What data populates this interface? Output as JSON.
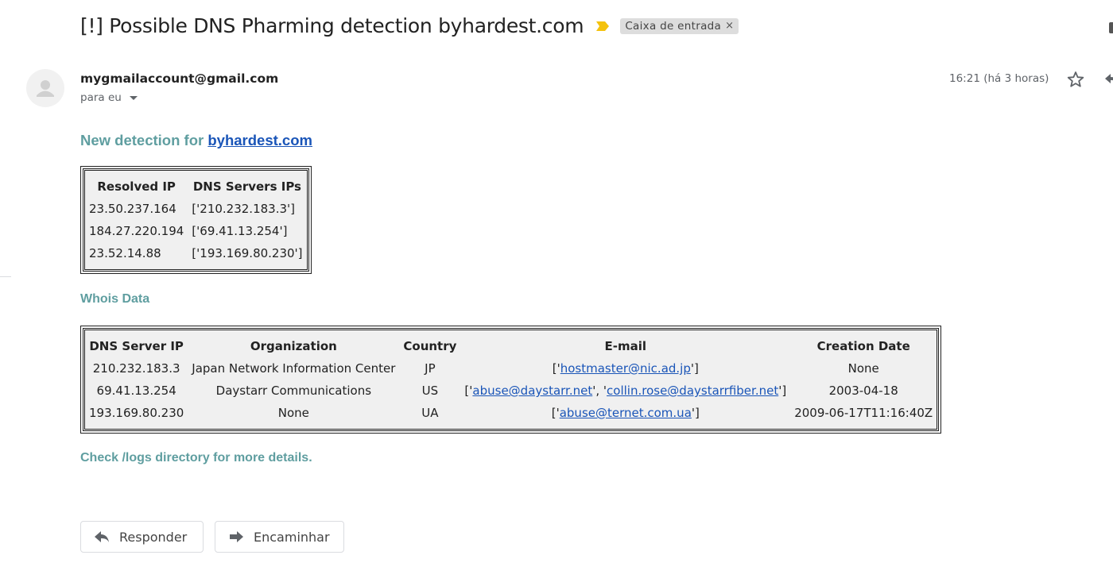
{
  "email": {
    "subject": "[!] Possible DNS Pharming detection byhardest.com",
    "label": "Caixa de entrada",
    "label_close": "×",
    "sender": "mygmailaccount@gmail.com",
    "recipient": "para eu",
    "timestamp": "16:21 (há 3 horas)"
  },
  "body": {
    "heading_prefix": "New detection for ",
    "heading_link": "byhardest.com",
    "resolved_table": {
      "headers": [
        "Resolved IP",
        "DNS Servers IPs"
      ],
      "rows": [
        [
          "23.50.237.164",
          "['210.232.183.3']"
        ],
        [
          "184.27.220.194",
          "['69.41.13.254']"
        ],
        [
          "23.52.14.88",
          "['193.169.80.230']"
        ]
      ]
    },
    "whois_title": "Whois Data",
    "whois_table": {
      "headers": [
        "DNS Server IP",
        "Organization",
        "Country",
        "E-mail",
        "Creation Date"
      ],
      "rows": [
        {
          "ip": "210.232.183.3",
          "org": "Japan Network Information Center",
          "country": "JP",
          "emails": [
            "hostmaster@nic.ad.jp"
          ],
          "created": "None"
        },
        {
          "ip": "69.41.13.254",
          "org": "Daystarr Communications",
          "country": "US",
          "emails": [
            "abuse@daystarr.net",
            "collin.rose@daystarrfiber.net"
          ],
          "created": "2003-04-18"
        },
        {
          "ip": "193.169.80.230",
          "org": "None",
          "country": "UA",
          "emails": [
            "abuse@ternet.com.ua"
          ],
          "created": "2009-06-17T11:16:40Z"
        }
      ]
    },
    "footer_note": "Check /logs directory for more details."
  },
  "actions": {
    "reply_label": "Responder",
    "forward_label": "Encaminhar"
  },
  "colors": {
    "accent_teal": "#5f9ea0",
    "link_blue": "#1a55b8",
    "importance_marker": "#f4c20d",
    "table_bg": "#f0f0f0"
  },
  "icons": [
    "importance-marker-icon",
    "avatar-icon",
    "chevron-down-icon",
    "star-icon",
    "reply-icon",
    "forward-icon"
  ]
}
